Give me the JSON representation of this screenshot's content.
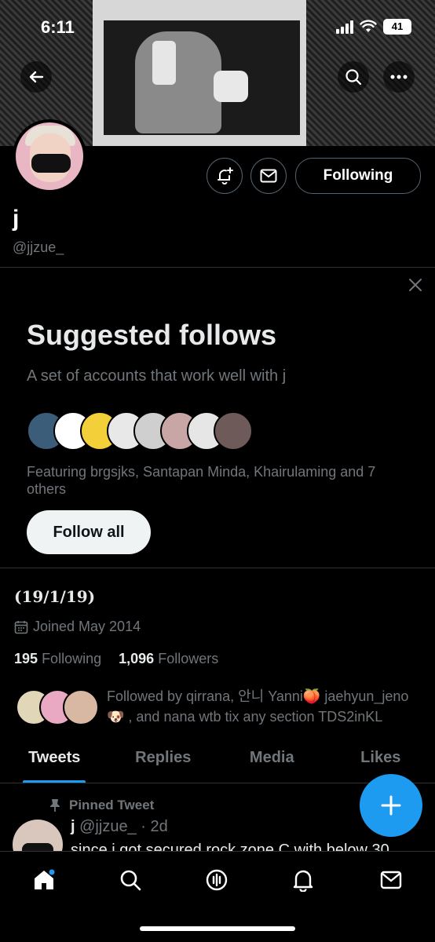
{
  "status_bar": {
    "time": "6:11",
    "battery": "41"
  },
  "profile": {
    "display_name": "j",
    "handle": "@jjzue_",
    "following_button": "Following",
    "bio": "(19/1/19)",
    "joined": "Joined May 2014",
    "following_count": "195",
    "following_label": "Following",
    "followers_count": "1,096",
    "followers_label": "Followers",
    "followed_by": "Followed by qirrana, 안니 Yanni🍑 jaehyun_jeno 🐶 , and nana wtb tix any section TDS2inKL"
  },
  "suggested": {
    "title": "Suggested follows",
    "subtitle": "A set of accounts that work well with j",
    "featuring": "Featuring brgsjks, Santapan Minda, Khairulaming and 7 others",
    "follow_all": "Follow all",
    "avatar_colors": [
      "#3b5d7a",
      "#ffffff",
      "#f3cf3a",
      "#e8e8e8",
      "#cfcfcf",
      "#c9a6a6",
      "#e6e6e6",
      "#6e5a58"
    ]
  },
  "tabs": [
    "Tweets",
    "Replies",
    "Media",
    "Likes"
  ],
  "pinned_tweet": {
    "pinned_label": "Pinned Tweet",
    "name": "j",
    "handle_time": "@jjzue_ · 2d",
    "text": "since i got secured rock zone C with below 30"
  },
  "icons": [
    "back-arrow-icon",
    "search-icon",
    "more-icon",
    "notification-bell-icon",
    "mail-icon",
    "close-icon",
    "calendar-icon",
    "pin-icon",
    "compose-plus-icon",
    "home-icon",
    "spaces-icon"
  ],
  "colors": {
    "accent": "#1d9bf0",
    "muted": "#71767b",
    "border": "#2f3336"
  }
}
